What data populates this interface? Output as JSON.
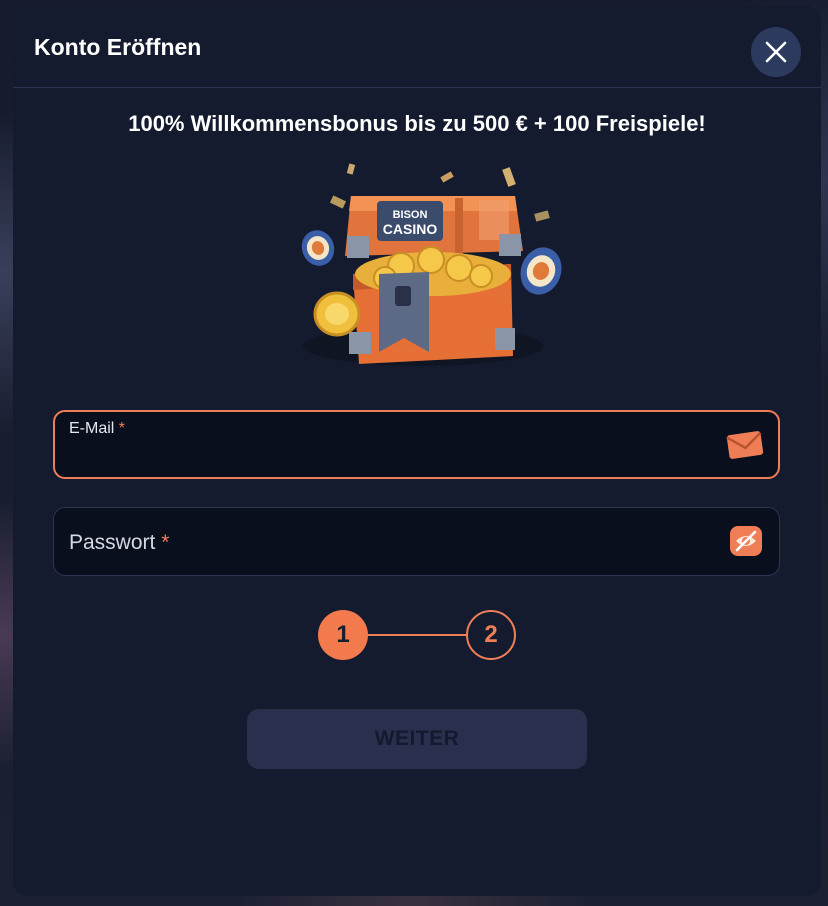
{
  "modal": {
    "title": "Konto Eröffnen",
    "close_icon": "close-icon"
  },
  "promo": {
    "headline": "100% Willkommensbonus bis zu 500 € + 100 Freispiele!",
    "image_icon": "treasure-chest-icon",
    "logo_text": "BISON CASINO"
  },
  "form": {
    "email": {
      "label": "E-Mail",
      "required_mark": "*",
      "value": "",
      "icon": "envelope-icon",
      "state": "focused"
    },
    "password": {
      "label": "Passwort",
      "required_mark": "*",
      "value": "",
      "icon": "eye-slash-icon"
    }
  },
  "stepper": {
    "current_step": "1",
    "next_step": "2"
  },
  "actions": {
    "next_label": "WEITER"
  },
  "colors": {
    "accent": "#ef7e57",
    "modal_bg": "#141b2e",
    "field_bg": "#0a0f1e",
    "button_disabled_bg": "#2a2f4e"
  }
}
